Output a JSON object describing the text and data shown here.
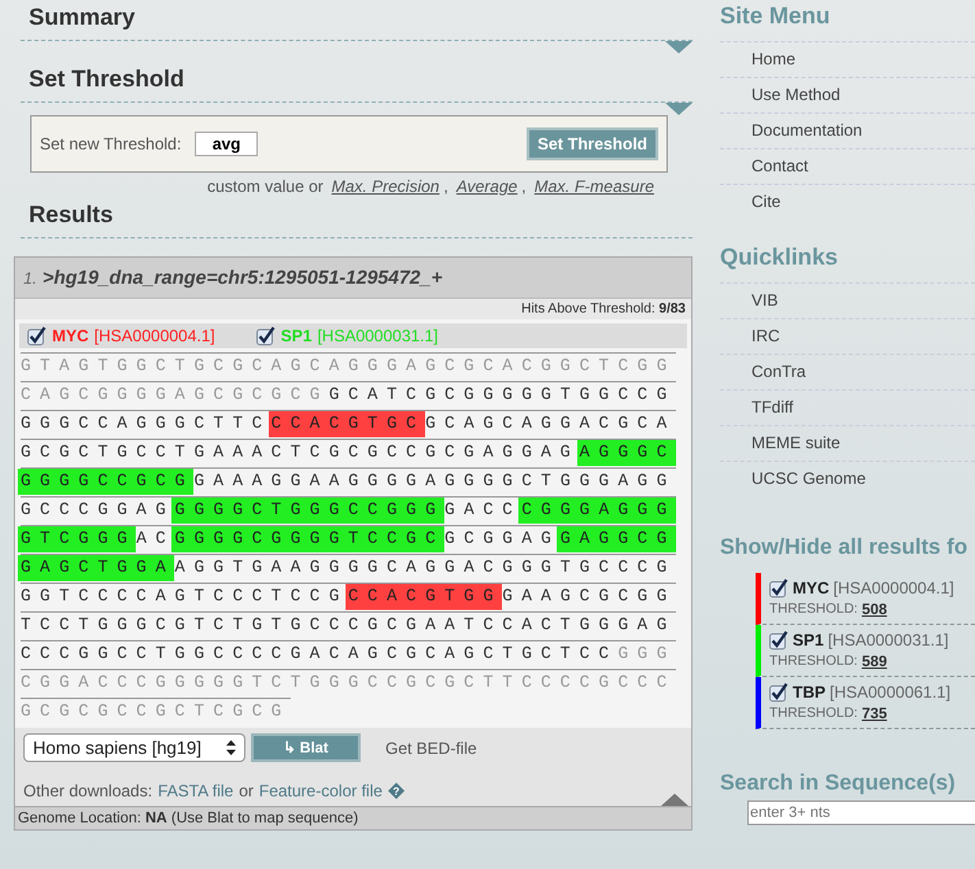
{
  "summary": {
    "heading": "Summary"
  },
  "threshold": {
    "heading": "Set Threshold",
    "label": "Set new Threshold:",
    "value": "avg",
    "button": "Set Threshold",
    "hint": "custom value or",
    "presets": [
      {
        "label": "Max. Precision",
        "separator": ","
      },
      {
        "label": "Average",
        "separator": ","
      },
      {
        "label": "Max. F-measure"
      }
    ]
  },
  "results": {
    "heading": "Results",
    "index": "1.",
    "name": ">hg19_dna_range=chr5:1295051-1295472_+",
    "hits": "Hits Above Threshold: **9/83**",
    "factors": [
      {
        "name": "MYC",
        "id": "[HSA0000004.1]",
        "color": "#ff2020",
        "checked": true
      },
      {
        "name": "SP1",
        "id": "[HSA0000031.1]",
        "color": "#22dd22",
        "checked": true
      }
    ],
    "rows": [
      {
        "segments": [
          {
            "kind": "flank",
            "text": "GTAGTGGCTGCGCAGCAGGGAGCGCACGGCTCGG"
          }
        ]
      },
      {
        "segments": [
          {
            "kind": "flank",
            "text": "CAGCGGGGAGCGCGCG"
          },
          {
            "kind": "core",
            "text": "GCATCGCGGGGGTGGCCG"
          }
        ]
      },
      {
        "segments": [
          {
            "kind": "core",
            "text": "GGGCCAGGGCTTC"
          },
          {
            "kind": "hit",
            "text": "CCACGTGC",
            "color": "#ff4040"
          },
          {
            "kind": "core",
            "text": "GCAGCAGGACGCA"
          }
        ]
      },
      {
        "segments": [
          {
            "kind": "core",
            "text": "GCGCTGCCTGAAACTCGCGCCGCGAGGAG"
          },
          {
            "kind": "hit",
            "text": "AGGGC",
            "color": "#22ee22"
          }
        ]
      },
      {
        "segments": [
          {
            "kind": "hit",
            "text": "GGGGCCGCG",
            "color": "#22ee22"
          },
          {
            "kind": "core",
            "text": "GAAAGGAAGGGGAGGGGCTGGGAGG"
          }
        ]
      },
      {
        "segments": [
          {
            "kind": "core",
            "text": "GCCCGGAG"
          },
          {
            "kind": "hit",
            "text": "GGGGCTGGGCCGGG",
            "color": "#22ee22"
          },
          {
            "kind": "core",
            "text": "GACC"
          },
          {
            "kind": "hit",
            "text": "CGGGAGGG",
            "color": "#22ee22"
          }
        ]
      },
      {
        "segments": [
          {
            "kind": "hit",
            "text": "GTCGGG",
            "color": "#22ee22"
          },
          {
            "kind": "core",
            "text": "AC"
          },
          {
            "kind": "hit",
            "text": "GGGGCGGGGTCCGC",
            "color": "#22ee22"
          },
          {
            "kind": "core",
            "text": "GCGGAG"
          },
          {
            "kind": "hit",
            "text": "GAGGCG",
            "color": "#22ee22"
          }
        ]
      },
      {
        "segments": [
          {
            "kind": "hit",
            "text": "GAGCTGGA",
            "color": "#22ee22"
          },
          {
            "kind": "core",
            "text": "AGGTGAAGGGGCAGGACGGGTGCCCG"
          }
        ]
      },
      {
        "segments": [
          {
            "kind": "core",
            "text": "GGTCCCCAGTCCCTCCG"
          },
          {
            "kind": "hit",
            "text": "CCACGTGG",
            "color": "#ff4040"
          },
          {
            "kind": "core",
            "text": "GAAGCGCGG"
          }
        ]
      },
      {
        "segments": [
          {
            "kind": "core",
            "text": "TCCTGGGCGTCTGTGCCCGCGAATCCACTGGGAG"
          }
        ]
      },
      {
        "segments": [
          {
            "kind": "core",
            "text": "CCCGGCCTGGCCCCGACAGCGCAGCTGCTCC"
          },
          {
            "kind": "flank",
            "text": "GGG"
          }
        ]
      },
      {
        "segments": [
          {
            "kind": "flank",
            "text": "CGGACCCGGGGGTCTGGGCCGCGCTTCCCCGCCC"
          }
        ]
      },
      {
        "segments": [
          {
            "kind": "flank",
            "text": "GCGCGCCGCTCGCG"
          }
        ]
      }
    ],
    "species": "Homo sapiens [hg19]",
    "blat_icon": "↳",
    "blat": "Blat",
    "bed": "Get BED-file",
    "downloads_label": "Other downloads:",
    "fasta": "FASTA file",
    "or": "or",
    "feature": "Feature-color file",
    "help_icon": "?",
    "location": "Genome Location: **NA** (Use Blat to map sequence)"
  },
  "site_menu": {
    "heading": "Site Menu",
    "items": [
      "Home",
      "Use Method",
      "Documentation",
      "Contact",
      "Cite"
    ]
  },
  "quicklinks": {
    "heading": "Quicklinks",
    "items": [
      "VIB",
      "IRC",
      "ConTra",
      "TFdiff",
      "MEME suite",
      "UCSC Genome"
    ]
  },
  "show_hide": {
    "heading": "Show/Hide all results fo",
    "items": [
      {
        "name": "MYC",
        "id": "[HSA0000004.1]",
        "threshold_label": "THRESHOLD:",
        "threshold": "508",
        "color": "#ff0000",
        "checked": true
      },
      {
        "name": "SP1",
        "id": "[HSA0000031.1]",
        "threshold_label": "THRESHOLD:",
        "threshold": "589",
        "color": "#00ee00",
        "checked": true
      },
      {
        "name": "TBP",
        "id": "[HSA0000061.1]",
        "threshold_label": "THRESHOLD:",
        "threshold": "735",
        "color": "#0000ff",
        "checked": true
      }
    ]
  },
  "search": {
    "heading": "Search in Sequence(s)",
    "placeholder": "enter 3+ nts"
  }
}
